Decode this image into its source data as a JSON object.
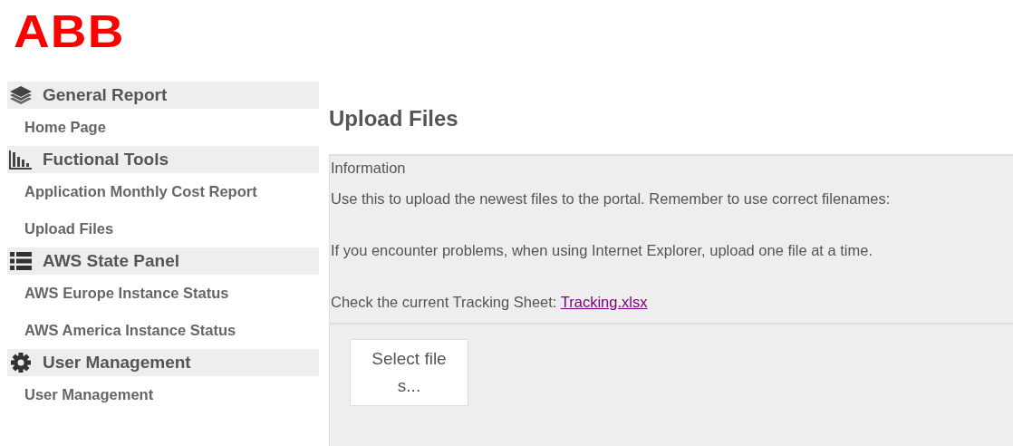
{
  "logo": {
    "text": "ABB"
  },
  "sidebar": {
    "sections": [
      {
        "title": "General Report",
        "items": [
          {
            "label": "Home Page"
          }
        ]
      },
      {
        "title": "Fuctional Tools",
        "items": [
          {
            "label": "Application Monthly Cost Report"
          },
          {
            "label": "Upload Files"
          }
        ]
      },
      {
        "title": "AWS State Panel",
        "items": [
          {
            "label": "AWS Europe Instance Status"
          },
          {
            "label": "AWS America Instance Status"
          }
        ]
      },
      {
        "title": "User Management",
        "items": [
          {
            "label": "User Management"
          }
        ]
      }
    ]
  },
  "main": {
    "title": "Upload Files",
    "info": {
      "heading": "Information",
      "lines": [
        {
          "text": "Use this to upload the newest files to the portal. Remember to use correct filenames:"
        },
        {
          "text": "If you encounter problems, when using Internet Explorer, upload one file at a time."
        },
        {
          "text": "Check the current Tracking Sheet:",
          "link": "Tracking.xlsx"
        }
      ]
    },
    "upload_button": "Select files..."
  }
}
